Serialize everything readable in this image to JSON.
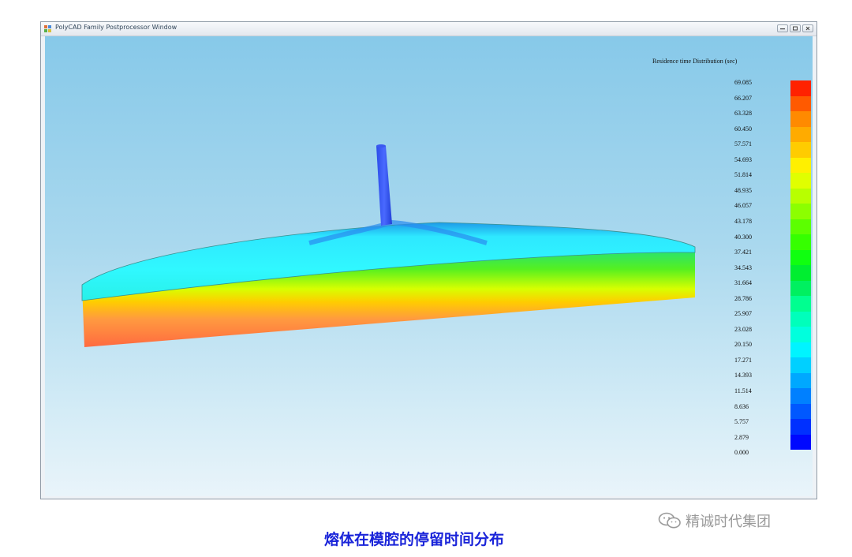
{
  "window": {
    "title": "PolyCAD Family Postprocessor Window",
    "icon": "app-icon",
    "controls": [
      "minimize-icon",
      "restore-icon",
      "close-icon"
    ]
  },
  "legend": {
    "title": "Residence time Distribution (sec)",
    "values": [
      "69.085",
      "66.207",
      "63.328",
      "60.450",
      "57.571",
      "54.693",
      "51.814",
      "48.935",
      "46.057",
      "43.178",
      "40.300",
      "37.421",
      "34.543",
      "31.664",
      "28.786",
      "25.907",
      "23.028",
      "20.150",
      "17.271",
      "14.393",
      "11.514",
      "8.636",
      "5.757",
      "2.879",
      "0.000"
    ],
    "colors": [
      "#ff2200",
      "#ff5a00",
      "#ff8a00",
      "#ffab00",
      "#ffcc00",
      "#fff000",
      "#e0ff00",
      "#b8ff00",
      "#8cff00",
      "#5cff00",
      "#36ff00",
      "#10ff10",
      "#00ee30",
      "#00f060",
      "#00ff90",
      "#00ffbb",
      "#00ffdd",
      "#00f4ff",
      "#00d0ff",
      "#00a8ff",
      "#0080ff",
      "#0058ff",
      "#0030ff",
      "#0008ff"
    ]
  },
  "caption": "熔体在模腔的停留时间分布",
  "watermark": {
    "icon": "wechat-icon",
    "text": "精诚时代集团"
  }
}
